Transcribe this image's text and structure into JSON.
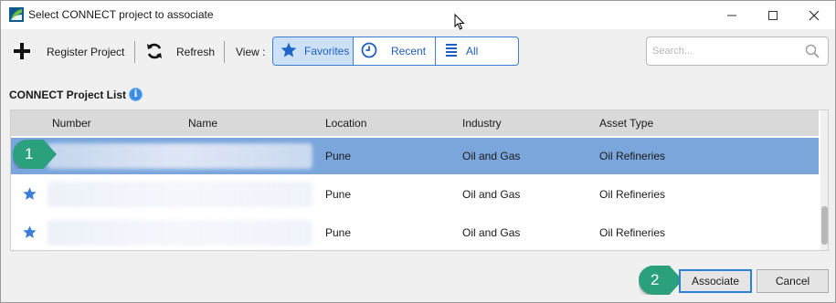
{
  "window": {
    "title": "Select CONNECT project to associate"
  },
  "toolbar": {
    "register_label": "Register Project",
    "refresh_label": "Refresh",
    "view_label": "View :",
    "views": [
      {
        "label": "Favorites",
        "icon": "star-icon",
        "active": true
      },
      {
        "label": "Recent",
        "icon": "clock-icon",
        "active": false
      },
      {
        "label": "All",
        "icon": "list-icon",
        "active": false
      }
    ],
    "search_placeholder": "Search..."
  },
  "list": {
    "title": "CONNECT Project List",
    "columns": [
      "Number",
      "Name",
      "Location",
      "Industry",
      "Asset Type"
    ],
    "rows": [
      {
        "favorite": false,
        "selected": true,
        "location": "Pune",
        "industry": "Oil and Gas",
        "asset_type": "Oil Refineries"
      },
      {
        "favorite": true,
        "selected": false,
        "location": "Pune",
        "industry": "Oil and Gas",
        "asset_type": "Oil Refineries"
      },
      {
        "favorite": true,
        "selected": false,
        "location": "Pune",
        "industry": "Oil and Gas",
        "asset_type": "Oil Refineries"
      }
    ]
  },
  "callouts": {
    "one": "1",
    "two": "2"
  },
  "buttons": {
    "associate": "Associate",
    "cancel": "Cancel"
  },
  "colors": {
    "accent": "#3b7dd8",
    "selected_row": "#7aa6dc",
    "callout": "#2aa07c",
    "star": "#3b7dd8"
  }
}
